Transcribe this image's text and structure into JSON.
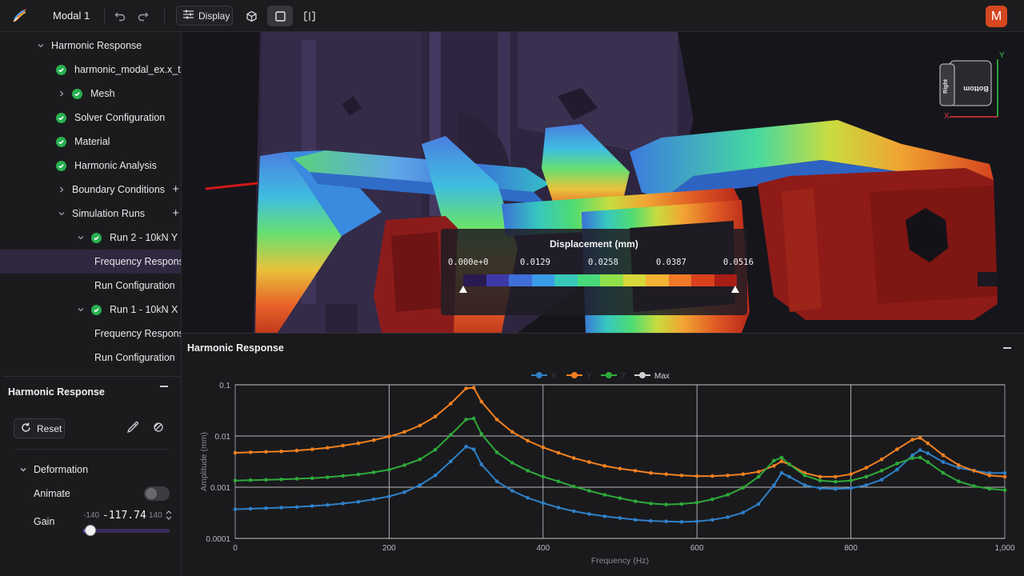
{
  "header": {
    "project_name": "Modal 1",
    "display_label": "Display",
    "avatar_letter": "M"
  },
  "tree": {
    "items": [
      {
        "label": "Harmonic Response",
        "indent": 1,
        "chevron": "down",
        "check": false,
        "plus": false,
        "selected": false
      },
      {
        "label": "harmonic_modal_ex.x_t",
        "indent": 2,
        "chevron": "none",
        "check": true,
        "plus": false,
        "selected": false
      },
      {
        "label": "Mesh",
        "indent": 2,
        "chevron": "right",
        "check": true,
        "plus": false,
        "selected": false
      },
      {
        "label": "Solver Configuration",
        "indent": 2,
        "chevron": "none",
        "check": true,
        "plus": false,
        "selected": false
      },
      {
        "label": "Material",
        "indent": 2,
        "chevron": "none",
        "check": true,
        "plus": false,
        "selected": false
      },
      {
        "label": "Harmonic Analysis",
        "indent": 2,
        "chevron": "none",
        "check": true,
        "plus": false,
        "selected": false
      },
      {
        "label": "Boundary Conditions",
        "indent": 2,
        "chevron": "right",
        "check": false,
        "plus": true,
        "selected": false
      },
      {
        "label": "Simulation Runs",
        "indent": 2,
        "chevron": "down",
        "check": false,
        "plus": true,
        "selected": false
      },
      {
        "label": "Run 2 - 10kN Y",
        "indent": 3,
        "chevron": "down",
        "check": true,
        "plus": false,
        "selected": false
      },
      {
        "label": "Frequency Response",
        "indent": 4,
        "chevron": "none",
        "check": false,
        "plus": false,
        "selected": true
      },
      {
        "label": "Run Configuration",
        "indent": 4,
        "chevron": "none",
        "check": false,
        "plus": false,
        "selected": false
      },
      {
        "label": "Run 1 - 10kN X",
        "indent": 3,
        "chevron": "down",
        "check": true,
        "plus": false,
        "selected": false
      },
      {
        "label": "Frequency Response",
        "indent": 4,
        "chevron": "none",
        "check": false,
        "plus": false,
        "selected": false
      },
      {
        "label": "Run Configuration",
        "indent": 4,
        "chevron": "none",
        "check": false,
        "plus": false,
        "selected": false
      }
    ]
  },
  "props_panel": {
    "title": "Harmonic Response",
    "reset_label": "Reset",
    "deformation_label": "Deformation",
    "animate_label": "Animate",
    "animate_on": false,
    "gain_label": "Gain",
    "gain_min": "-140",
    "gain_value": "-117.74",
    "gain_max": "140",
    "gain_min_num": -140,
    "gain_max_num": 140,
    "gain_num": -117.74
  },
  "viewport": {
    "colorbar": {
      "title": "Displacement (mm)",
      "ticks": [
        "0.000e+0",
        "0.0129",
        "0.0258",
        "0.0387",
        "0.0516"
      ],
      "colors": [
        "#2b1a52",
        "#3d3aa8",
        "#3f6fd8",
        "#3a9be6",
        "#36c7b8",
        "#47d97a",
        "#8fe04a",
        "#d6d83a",
        "#f2b233",
        "#f07a28",
        "#d8401e",
        "#a81d16"
      ]
    },
    "orientation_cube": {
      "axis_y": "Y",
      "axis_x": "X",
      "face_front": "Bottom",
      "face_side": "Right"
    }
  },
  "plot_panel": {
    "title": "Harmonic Response"
  },
  "chart_data": {
    "type": "line",
    "title": "",
    "xlabel": "Frequency (Hz)",
    "ylabel": "Amplitude (mm)",
    "xlim": [
      0,
      1000
    ],
    "ylim": [
      0.0001,
      0.1
    ],
    "yscale": "log",
    "x_ticks": [
      "0",
      "200",
      "400",
      "600",
      "800",
      "1,000"
    ],
    "y_ticks": [
      "0.1",
      "0.01",
      "0.001",
      "0.0001"
    ],
    "grid": true,
    "legend": {
      "placement": "top-center",
      "items": [
        "X",
        "Y",
        "Z",
        "Max"
      ]
    },
    "colors": {
      "X": "#2f80c8",
      "Y": "#f28020",
      "Z": "#2eaa3a",
      "Max": "#cfcfd2"
    },
    "x": [
      0,
      20,
      40,
      60,
      80,
      100,
      120,
      140,
      160,
      180,
      200,
      220,
      240,
      260,
      280,
      300,
      310,
      320,
      340,
      360,
      380,
      400,
      420,
      440,
      460,
      480,
      500,
      520,
      540,
      560,
      580,
      600,
      620,
      640,
      660,
      680,
      700,
      710,
      720,
      740,
      760,
      780,
      800,
      820,
      840,
      860,
      880,
      890,
      900,
      920,
      940,
      960,
      980,
      1000
    ],
    "series": [
      {
        "name": "X",
        "values": [
          0.00037,
          0.00038,
          0.00039,
          0.0004,
          0.00041,
          0.00043,
          0.00045,
          0.00048,
          0.00052,
          0.00058,
          0.00066,
          0.0008,
          0.0011,
          0.0017,
          0.0032,
          0.0062,
          0.0055,
          0.0028,
          0.0013,
          0.00085,
          0.00062,
          0.00049,
          0.0004,
          0.00034,
          0.0003,
          0.00027,
          0.00025,
          0.00023,
          0.00022,
          0.000215,
          0.00021,
          0.000215,
          0.00023,
          0.00026,
          0.00032,
          0.00047,
          0.0011,
          0.0019,
          0.0016,
          0.0011,
          0.00095,
          0.00092,
          0.00095,
          0.0011,
          0.0014,
          0.0022,
          0.0042,
          0.0053,
          0.0046,
          0.0031,
          0.0024,
          0.0021,
          0.0019,
          0.0019
        ]
      },
      {
        "name": "Y",
        "values": [
          0.0047,
          0.0048,
          0.0049,
          0.005,
          0.0052,
          0.0055,
          0.0059,
          0.0065,
          0.0072,
          0.0083,
          0.0098,
          0.012,
          0.016,
          0.024,
          0.043,
          0.085,
          0.088,
          0.047,
          0.021,
          0.012,
          0.0081,
          0.006,
          0.0047,
          0.0037,
          0.0031,
          0.0026,
          0.0023,
          0.0021,
          0.0019,
          0.0018,
          0.0017,
          0.00165,
          0.00165,
          0.0017,
          0.0018,
          0.002,
          0.0026,
          0.0032,
          0.0028,
          0.0019,
          0.0016,
          0.0016,
          0.0018,
          0.0024,
          0.0035,
          0.0055,
          0.0085,
          0.0092,
          0.0072,
          0.0042,
          0.0027,
          0.0021,
          0.0017,
          0.0016
        ]
      },
      {
        "name": "Z",
        "values": [
          0.00135,
          0.00137,
          0.00139,
          0.00142,
          0.00146,
          0.0015,
          0.00157,
          0.00166,
          0.00178,
          0.00195,
          0.0022,
          0.0027,
          0.0035,
          0.0054,
          0.0105,
          0.021,
          0.022,
          0.011,
          0.0048,
          0.003,
          0.0021,
          0.0016,
          0.0013,
          0.00103,
          0.00085,
          0.00071,
          0.00061,
          0.00053,
          0.00048,
          0.00046,
          0.00047,
          0.0005,
          0.00058,
          0.00071,
          0.00098,
          0.0016,
          0.0033,
          0.0038,
          0.0028,
          0.0017,
          0.00135,
          0.00128,
          0.00135,
          0.0016,
          0.0021,
          0.0029,
          0.0037,
          0.0038,
          0.0031,
          0.0019,
          0.0013,
          0.00105,
          0.00093,
          0.00088
        ]
      },
      {
        "name": "Max",
        "values": []
      }
    ]
  }
}
